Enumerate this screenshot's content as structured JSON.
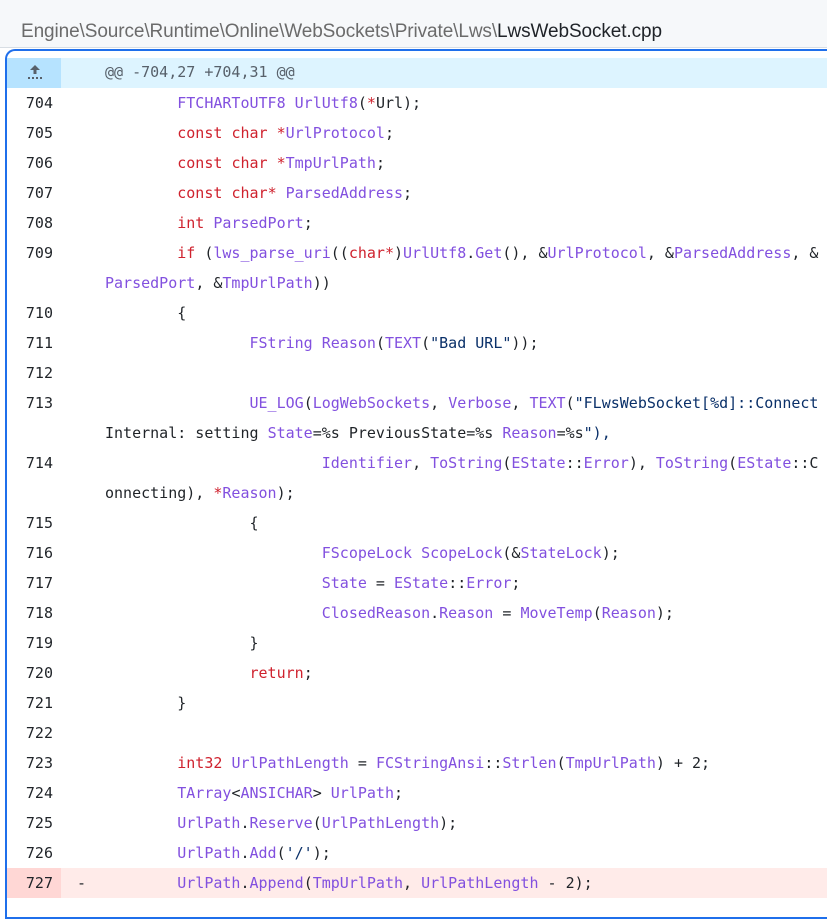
{
  "breadcrumb": {
    "path": "Engine\\Source\\Runtime\\Online\\WebSockets\\Private\\Lws\\",
    "file": "LwsWebSocket.cpp"
  },
  "hunk": {
    "header": "@@ -704,27 +704,31 @@",
    "expand_icon": "expand-up-icon"
  },
  "lines": [
    {
      "num": "704",
      "text": "        FTCHARToUTF8 UrlUtf8(*Url);"
    },
    {
      "num": "705",
      "text": "        const char *UrlProtocol;"
    },
    {
      "num": "706",
      "text": "        const char *TmpUrlPath;"
    },
    {
      "num": "707",
      "text": "        const char* ParsedAddress;"
    },
    {
      "num": "708",
      "text": "        int ParsedPort;"
    },
    {
      "num": "709",
      "text": "        if (lws_parse_uri((char*)UrlUtf8.Get(), &UrlProtocol, &ParsedAddress, &",
      "wrap": "ParsedPort, &TmpUrlPath))"
    },
    {
      "num": "710",
      "text": "        {"
    },
    {
      "num": "711",
      "text": "                FString Reason(TEXT(\"Bad URL\"));"
    },
    {
      "num": "712",
      "text": ""
    },
    {
      "num": "713",
      "text": "                UE_LOG(LogWebSockets, Verbose, TEXT(\"FLwsWebSocket[%d]::Connect",
      "wrap": "Internal: setting State=%s PreviousState=%s Reason=%s\"),"
    },
    {
      "num": "714",
      "text": "                        Identifier, ToString(EState::Error), ToString(EState::C",
      "wrap": "onnecting), *Reason);"
    },
    {
      "num": "715",
      "text": "                {"
    },
    {
      "num": "716",
      "text": "                        FScopeLock ScopeLock(&StateLock);"
    },
    {
      "num": "717",
      "text": "                        State = EState::Error;"
    },
    {
      "num": "718",
      "text": "                        ClosedReason.Reason = MoveTemp(Reason);"
    },
    {
      "num": "719",
      "text": "                }"
    },
    {
      "num": "720",
      "text": "                return;"
    },
    {
      "num": "721",
      "text": "        }"
    },
    {
      "num": "722",
      "text": ""
    },
    {
      "num": "723",
      "text": "        int32 UrlPathLength = FCStringAnsi::Strlen(TmpUrlPath) + 2;"
    },
    {
      "num": "724",
      "text": "        TArray<ANSICHAR> UrlPath;"
    },
    {
      "num": "725",
      "text": "        UrlPath.Reserve(UrlPathLength);"
    },
    {
      "num": "726",
      "text": "        UrlPath.Add('/');"
    },
    {
      "num": "727",
      "text": "        UrlPath.Append(TmpUrlPath, UrlPathLength - 2);",
      "deleted": true,
      "sign": "-"
    }
  ],
  "colors": {
    "keyword": "#cf222e",
    "function": "#8250df",
    "string": "#0a3069",
    "deleted_bg": "#ffebe9",
    "hunk_bg": "#ddf4ff",
    "focus_border": "#1f6feb"
  }
}
